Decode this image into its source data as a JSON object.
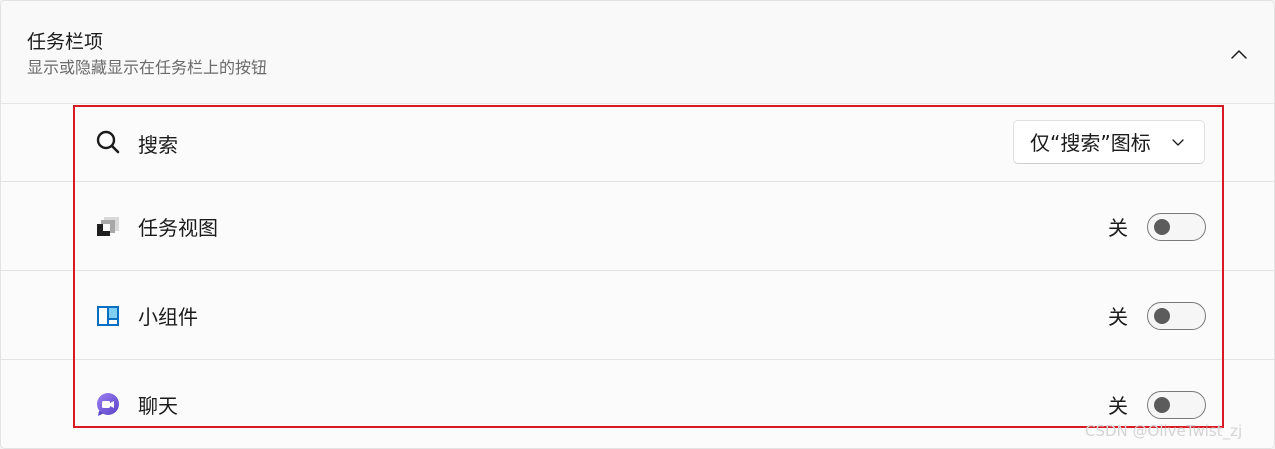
{
  "section": {
    "title": "任务栏项",
    "subtitle": "显示或隐藏显示在任务栏上的按钮",
    "collapse_icon": "chevron-up-icon"
  },
  "items": [
    {
      "id": "search",
      "label": "搜索",
      "icon": "search-icon",
      "control": "dropdown",
      "selected_value": "仅“搜索”图标"
    },
    {
      "id": "task-view",
      "label": "任务视图",
      "icon": "task-view-icon",
      "control": "toggle",
      "state_label": "关",
      "on": false
    },
    {
      "id": "widgets",
      "label": "小组件",
      "icon": "widgets-icon",
      "control": "toggle",
      "state_label": "关",
      "on": false
    },
    {
      "id": "chat",
      "label": "聊天",
      "icon": "chat-icon",
      "control": "toggle",
      "state_label": "关",
      "on": false
    }
  ],
  "watermark": "CSDN @OliveTwist_zj",
  "colors": {
    "highlight_border": "#d91a22",
    "widgets_blue": "#0a6fc2",
    "chat_purple": "#7b5cd6"
  }
}
